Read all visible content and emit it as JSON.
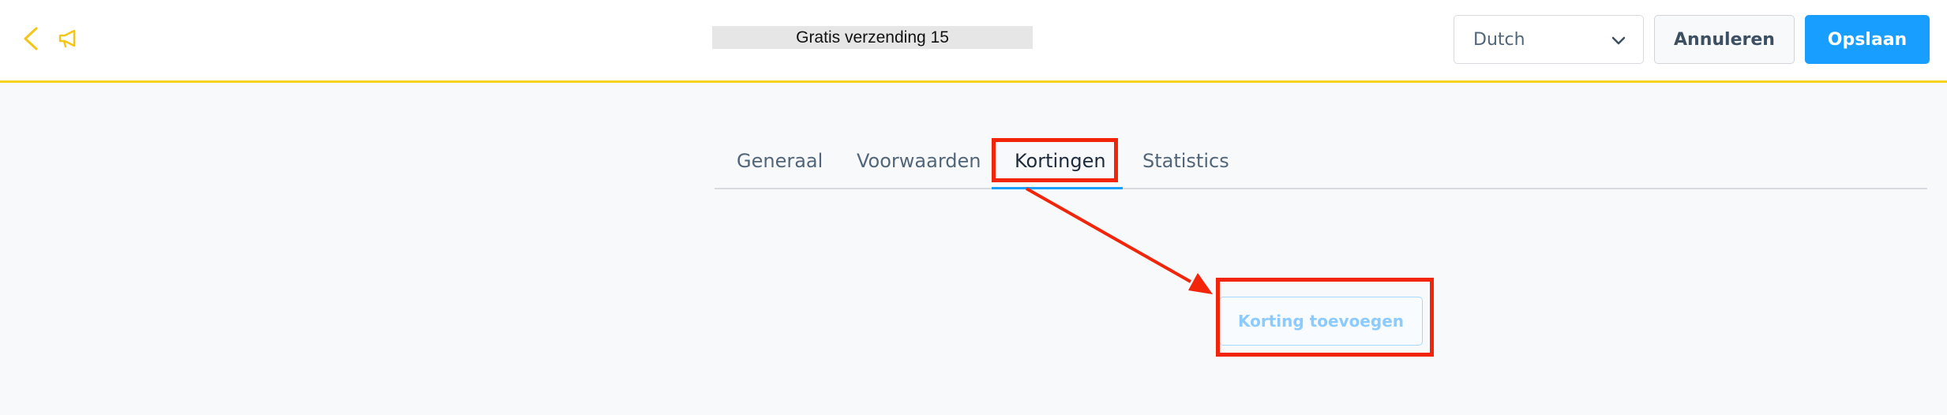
{
  "header": {
    "title": "Gratis verzending 15",
    "language": "Dutch",
    "cancel_label": "Annuleren",
    "save_label": "Opslaan",
    "accent_color": "#f5d21c",
    "primary_color": "#189eff"
  },
  "icons": {
    "back": "chevron-left-icon",
    "promotion": "megaphone-icon",
    "select": "chevron-down-icon"
  },
  "tabs": [
    {
      "label": "Generaal",
      "active": false
    },
    {
      "label": "Voorwaarden",
      "active": false
    },
    {
      "label": "Kortingen",
      "active": true
    },
    {
      "label": "Statistics",
      "active": false
    }
  ],
  "main": {
    "add_discount_label": "Korting toevoegen"
  },
  "annotation": {
    "color": "#f2250a"
  }
}
